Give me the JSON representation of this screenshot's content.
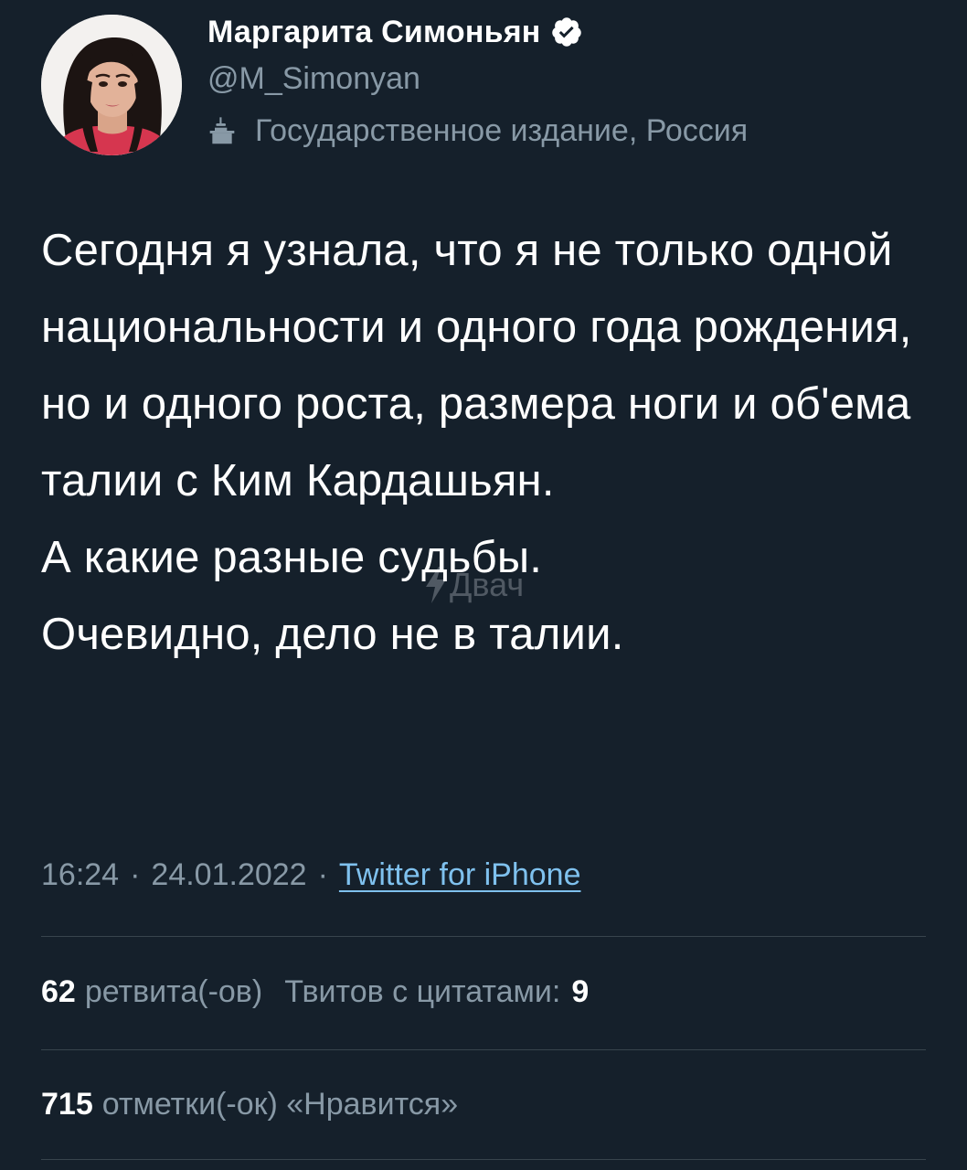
{
  "author": {
    "display_name": "Маргарита Симоньян",
    "handle": "@M_Simonyan",
    "label": "Государственное издание, Россия",
    "verified": true,
    "icons": {
      "verified": "verified-badge-icon",
      "label": "state-media-podium-icon"
    }
  },
  "tweet": {
    "paragraphs": [
      "Сегодня я узнала, что я не только одной национальности и одного года рождения, но и одного роста, размера ноги и об'ема талии с Ким Кардашьян.",
      "А какие разные судьбы.",
      "Очевидно, дело не в талии."
    ],
    "time": "16:24",
    "date": "24.01.2022",
    "separator": "·",
    "source": "Twitter for iPhone"
  },
  "stats": {
    "retweets_count": "62",
    "retweets_label": "ретвита(-ов)",
    "quotes_label": "Твитов с цитатами:",
    "quotes_count": "9",
    "likes_count": "715",
    "likes_label": "отметки(-ок) «Нравится»"
  },
  "watermark": {
    "text": "Двач"
  },
  "colors": {
    "background": "#15202b",
    "text": "#ffffff",
    "secondary": "#8899a6",
    "link": "#7fc1ee",
    "divider": "#38444d"
  }
}
